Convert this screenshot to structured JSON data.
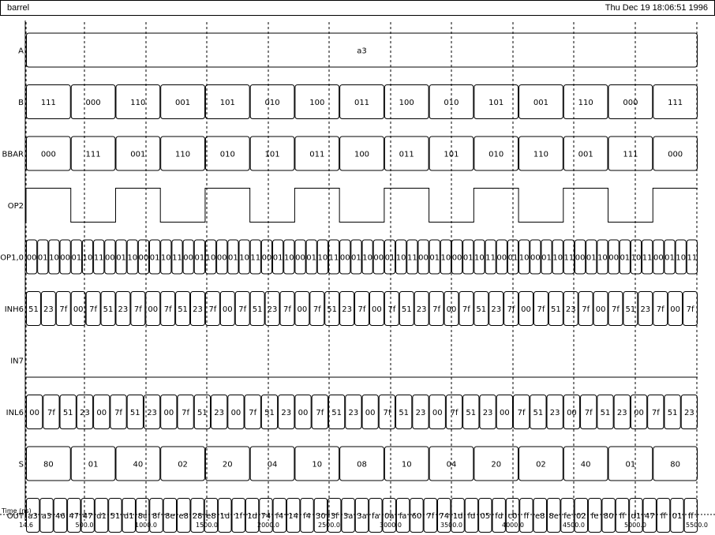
{
  "window": {
    "title": "barrel",
    "timestamp": "Thu Dec 19 18:06:51 1996"
  },
  "axis": {
    "label": "Time (ns)",
    "ticks": [
      "14.6",
      "500.0",
      "1000.0",
      "1500.0",
      "2000.0",
      "2500.0",
      "3000.0",
      "3500.0",
      "4000.0",
      "4500.0",
      "5000.0",
      "5500.0"
    ]
  },
  "signals": [
    {
      "name": "A",
      "type": "bus",
      "values": [
        "a3"
      ]
    },
    {
      "name": "B",
      "type": "bus",
      "values": [
        "111",
        "000",
        "110",
        "001",
        "101",
        "010",
        "100",
        "011",
        "100",
        "010",
        "101",
        "001",
        "110",
        "000",
        "111"
      ]
    },
    {
      "name": "BBAR",
      "type": "bus",
      "values": [
        "000",
        "111",
        "001",
        "110",
        "010",
        "101",
        "011",
        "100",
        "011",
        "101",
        "010",
        "110",
        "001",
        "111",
        "000"
      ]
    },
    {
      "name": "OP2",
      "type": "bit"
    },
    {
      "name": "OP1,0",
      "type": "bus",
      "values": [
        "00",
        "01",
        "10",
        "00",
        "01",
        "10",
        "11",
        "00",
        "01",
        "10",
        "00",
        "01",
        "10",
        "11",
        "00",
        "01",
        "10",
        "00",
        "01",
        "10",
        "11",
        "00",
        "01",
        "10",
        "00",
        "01",
        "10",
        "11",
        "00",
        "01",
        "10",
        "00",
        "01",
        "10",
        "11",
        "00",
        "01",
        "10",
        "00",
        "01",
        "10",
        "11",
        "00",
        "01",
        "10",
        "00",
        "01",
        "10",
        "11",
        "00",
        "01",
        "10",
        "00",
        "01",
        "10",
        "11",
        "00",
        "01",
        "10",
        "11"
      ]
    },
    {
      "name": "INH6",
      "type": "bus",
      "values": [
        "51",
        "23",
        "7f",
        "00",
        "7f",
        "51",
        "23",
        "7f",
        "00",
        "7f",
        "51",
        "23",
        "7f",
        "00",
        "7f",
        "51",
        "23",
        "7f",
        "00",
        "7f",
        "51",
        "23",
        "7f",
        "00",
        "7f",
        "51",
        "23",
        "7f",
        "00",
        "7f",
        "51",
        "23",
        "7f",
        "00",
        "7f",
        "51",
        "23",
        "7f",
        "00",
        "7f",
        "51",
        "23",
        "7f",
        "00",
        "7f"
      ]
    },
    {
      "name": "IN7",
      "type": "none"
    },
    {
      "name": "INL6",
      "type": "bus",
      "values": [
        "00",
        "7f",
        "51",
        "23",
        "00",
        "7f",
        "51",
        "23",
        "00",
        "7f",
        "51",
        "23",
        "00",
        "7f",
        "51",
        "23",
        "00",
        "7f",
        "51",
        "23",
        "00",
        "7f",
        "51",
        "23",
        "00",
        "7f",
        "51",
        "23",
        "00",
        "7f",
        "51",
        "23",
        "00",
        "7f",
        "51",
        "23",
        "00",
        "7f",
        "51",
        "23"
      ]
    },
    {
      "name": "S",
      "type": "bus",
      "values": [
        "80",
        "01",
        "40",
        "02",
        "20",
        "04",
        "10",
        "08",
        "10",
        "04",
        "20",
        "02",
        "40",
        "01",
        "80"
      ]
    },
    {
      "name": "OUT",
      "type": "bus",
      "values": [
        "a3",
        "a3",
        "46",
        "47",
        "47",
        "d1",
        "51",
        "d1",
        "8c",
        "8f",
        "8e",
        "e8",
        "28",
        "e8",
        "1d",
        "1f",
        "1d",
        "74",
        "f4",
        "14",
        "f4",
        "30",
        "3f",
        "3a",
        "3a",
        "fa",
        "0a",
        "fa",
        "60",
        "7f",
        "74",
        "1d",
        "fd",
        "05",
        "fd",
        "c0",
        "ff",
        "e8",
        "8e",
        "fe",
        "02",
        "fe",
        "80",
        "ff",
        "d1",
        "47",
        "ff",
        "01",
        "ff"
      ]
    }
  ]
}
